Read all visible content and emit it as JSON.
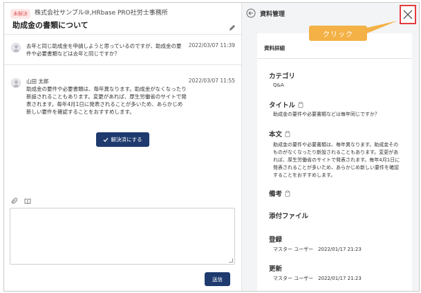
{
  "ticket": {
    "status_badge": "未解決",
    "company": "株式会社サンプル⑩,HRbase PRO社労士事務所",
    "subject": "助成金の書類について"
  },
  "messages": [
    {
      "text": "去年と同じ助成金を申請しようと思っているのですが、助成金の要件や必要書類などは去年と同じですか？",
      "time": "2022/03/07 11:39"
    },
    {
      "author": "山田 太郎",
      "text": "助成金の要件や必要書類は、毎年異なります。助成金がなくなったり新設されることもあります。変更があれば、厚生労働省のサイトで発表されます。毎年4月1日に発表されることが多いため、あらかじめ新しい要件を確認することをおすすめします。",
      "time": "2022/03/07 11:55"
    }
  ],
  "actions": {
    "resolve_label": "解決済にする",
    "send_label": "送信"
  },
  "panel": {
    "title": "資料管理",
    "callout": "クリック",
    "card_title": "資料詳細",
    "fields": {
      "category_label": "カテゴリ",
      "category_value": "Q&A",
      "title_label": "タイトル",
      "title_value": "助成金の要件や必要書類などは毎年同じですか？",
      "body_label": "本文",
      "body_value": "助成金の要件や必要書類は、毎年異なります。助成金そのものがなくなったり新設されることもあります。変更があれば、厚生労働省のサイトで発表されます。毎年4月1日に発表されることが多いため、あらかじめ新しい要件を確認することをおすすめします。",
      "note_label": "備考",
      "attachment_label": "添付ファイル",
      "registered_label": "登録",
      "registered_value": "マスター ユーザー　2022/01/17 21:23",
      "updated_label": "更新",
      "updated_value": "マスター ユーザー　2022/01/17 21:23"
    }
  },
  "colors": {
    "primary": "#1e3a6e",
    "badge_bg": "#fde7e7",
    "badge_text": "#e05555",
    "callout": "#f3b146",
    "highlight": "#e53b3b"
  }
}
